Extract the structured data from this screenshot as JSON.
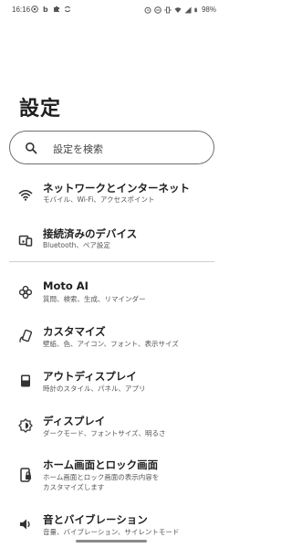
{
  "status_bar": {
    "time": "16:16",
    "battery": "98%"
  },
  "page": {
    "title": "設定"
  },
  "search": {
    "placeholder": "設定を検索"
  },
  "items": [
    {
      "title": "ネットワークとインターネット",
      "subtitle": "モバイル、Wi-Fi、アクセスポイント",
      "icon": "wifi-icon"
    },
    {
      "title": "接続済みのデバイス",
      "subtitle": "Bluetooth、ペア設定",
      "icon": "connected-devices-icon"
    },
    {
      "title": "Moto AI",
      "subtitle": "質問、検索、生成、リマインダー",
      "icon": "moto-ai-icon"
    },
    {
      "title": "カスタマイズ",
      "subtitle": "壁紙、色、アイコン、フォント、表示サイズ",
      "icon": "customize-icon"
    },
    {
      "title": "アウトディスプレイ",
      "subtitle": "時計のスタイル、パネル、アプリ",
      "icon": "outer-display-icon"
    },
    {
      "title": "ディスプレイ",
      "subtitle": "ダークモード、フォントサイズ、明るさ",
      "icon": "display-icon"
    },
    {
      "title": "ホーム画面とロック画面",
      "subtitle_line1": "ホーム画面とロック画面の表示内容を",
      "subtitle_line2": "カスタマイズします",
      "icon": "home-lock-icon"
    },
    {
      "title": "音とバイブレーション",
      "subtitle": "音量、バイブレーション、サイレントモード",
      "icon": "sound-icon"
    }
  ]
}
